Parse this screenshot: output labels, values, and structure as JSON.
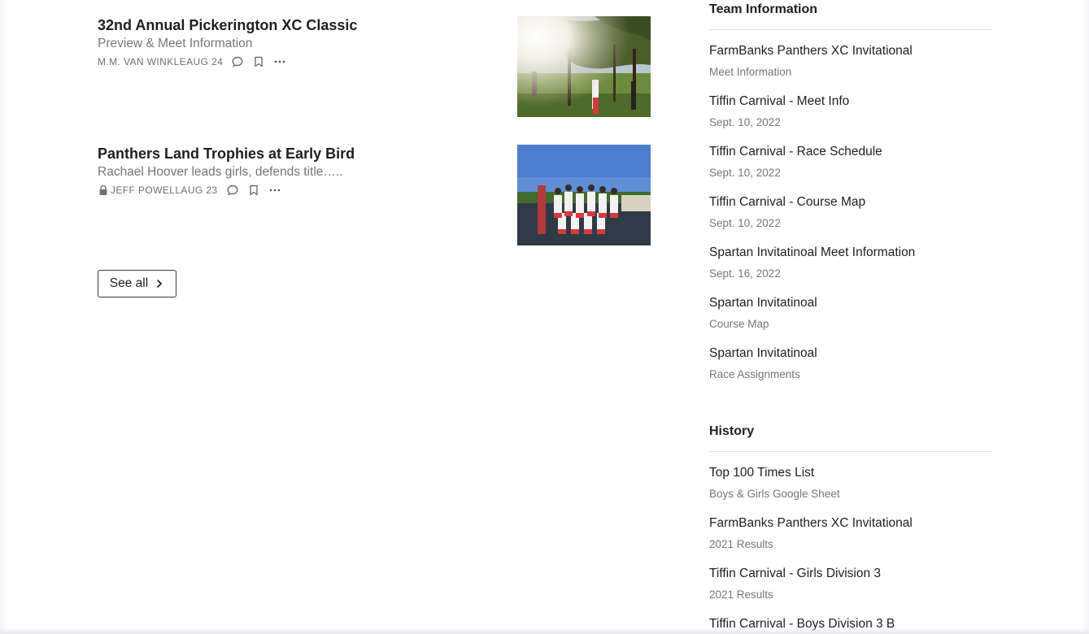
{
  "posts": [
    {
      "title": "32nd Annual Pickerington XC Classic",
      "subtitle": "Preview & Meet Information",
      "author": "M.M. VAN WINKLE",
      "date": "AUG 24",
      "locked": false,
      "thumbnail": "runners-under-trees-photo"
    },
    {
      "title": "Panthers Land Trophies at Early Bird",
      "subtitle": "Rachael Hoover leads girls, defends title…..",
      "author": "JEFF POWELL",
      "date": "AUG 23",
      "locked": true,
      "thumbnail": "girls-team-group-photo"
    }
  ],
  "see_all": {
    "label": "See all"
  },
  "sidebar": {
    "team_information": {
      "heading": "Team Information",
      "links": [
        {
          "title": "FarmBanks Panthers XC Invitational",
          "sub": "Meet Information"
        },
        {
          "title": "Tiffin Carnival - Meet Info",
          "sub": "Sept. 10, 2022"
        },
        {
          "title": "Tiffin Carnival - Race Schedule",
          "sub": "Sept. 10, 2022"
        },
        {
          "title": "Tiffin Carnival - Course Map",
          "sub": "Sept. 10, 2022"
        },
        {
          "title": "Spartan Invitatinoal Meet Information",
          "sub": "Sept. 16, 2022"
        },
        {
          "title": "Spartan Invitatinoal",
          "sub": "Course Map"
        },
        {
          "title": "Spartan Invitatinoal",
          "sub": "Race Assignments"
        }
      ]
    },
    "history": {
      "heading": "History",
      "links": [
        {
          "title": "Top 100 Times List",
          "sub": "Boys & Girls Google Sheet"
        },
        {
          "title": "FarmBanks Panthers XC Invitational",
          "sub": "2021 Results"
        },
        {
          "title": "Tiffin Carnival - Girls Division 3",
          "sub": "2021 Results"
        },
        {
          "title": "Tiffin Carnival - Boys Division 3 B",
          "sub": ""
        }
      ]
    }
  },
  "colors": {
    "text": "#1f1f1f",
    "muted": "#767676",
    "rule": "#e3e3e3"
  }
}
